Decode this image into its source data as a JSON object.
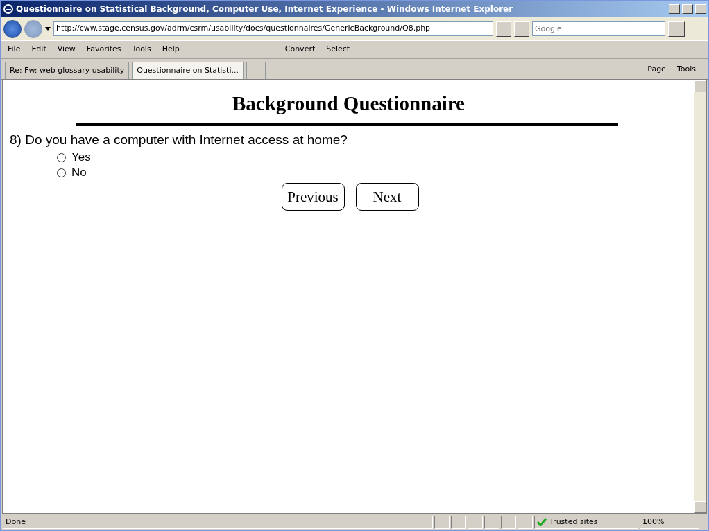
{
  "window": {
    "title": "Questionnaire on Statistical Background, Computer Use, Internet Experience - Windows Internet Explorer"
  },
  "address_bar": {
    "url": "http://cww.stage.census.gov/adrm/csrm/usability/docs/questionnaires/GenericBackground/Q8.php"
  },
  "search": {
    "placeholder": "Google"
  },
  "menu": [
    "File",
    "Edit",
    "View",
    "Favorites",
    "Tools",
    "Help"
  ],
  "toolbar": [
    "Convert",
    "Select"
  ],
  "tabs": [
    {
      "label": "Re: Fw: web glossary usability",
      "selected": false
    },
    {
      "label": "Questionnaire on Statisti...",
      "selected": true
    }
  ],
  "command_bar": [
    "Page",
    "Tools"
  ],
  "page": {
    "heading": "Background Questionnaire",
    "question": "8) Do you have a computer with Internet access at home?",
    "options": [
      {
        "label": "Yes",
        "selected": false
      },
      {
        "label": "No",
        "selected": false
      }
    ],
    "buttons": [
      "Previous",
      "Next"
    ]
  },
  "status_bar": {
    "text": "Done",
    "zone": "Trusted sites",
    "zoom": "100%"
  }
}
